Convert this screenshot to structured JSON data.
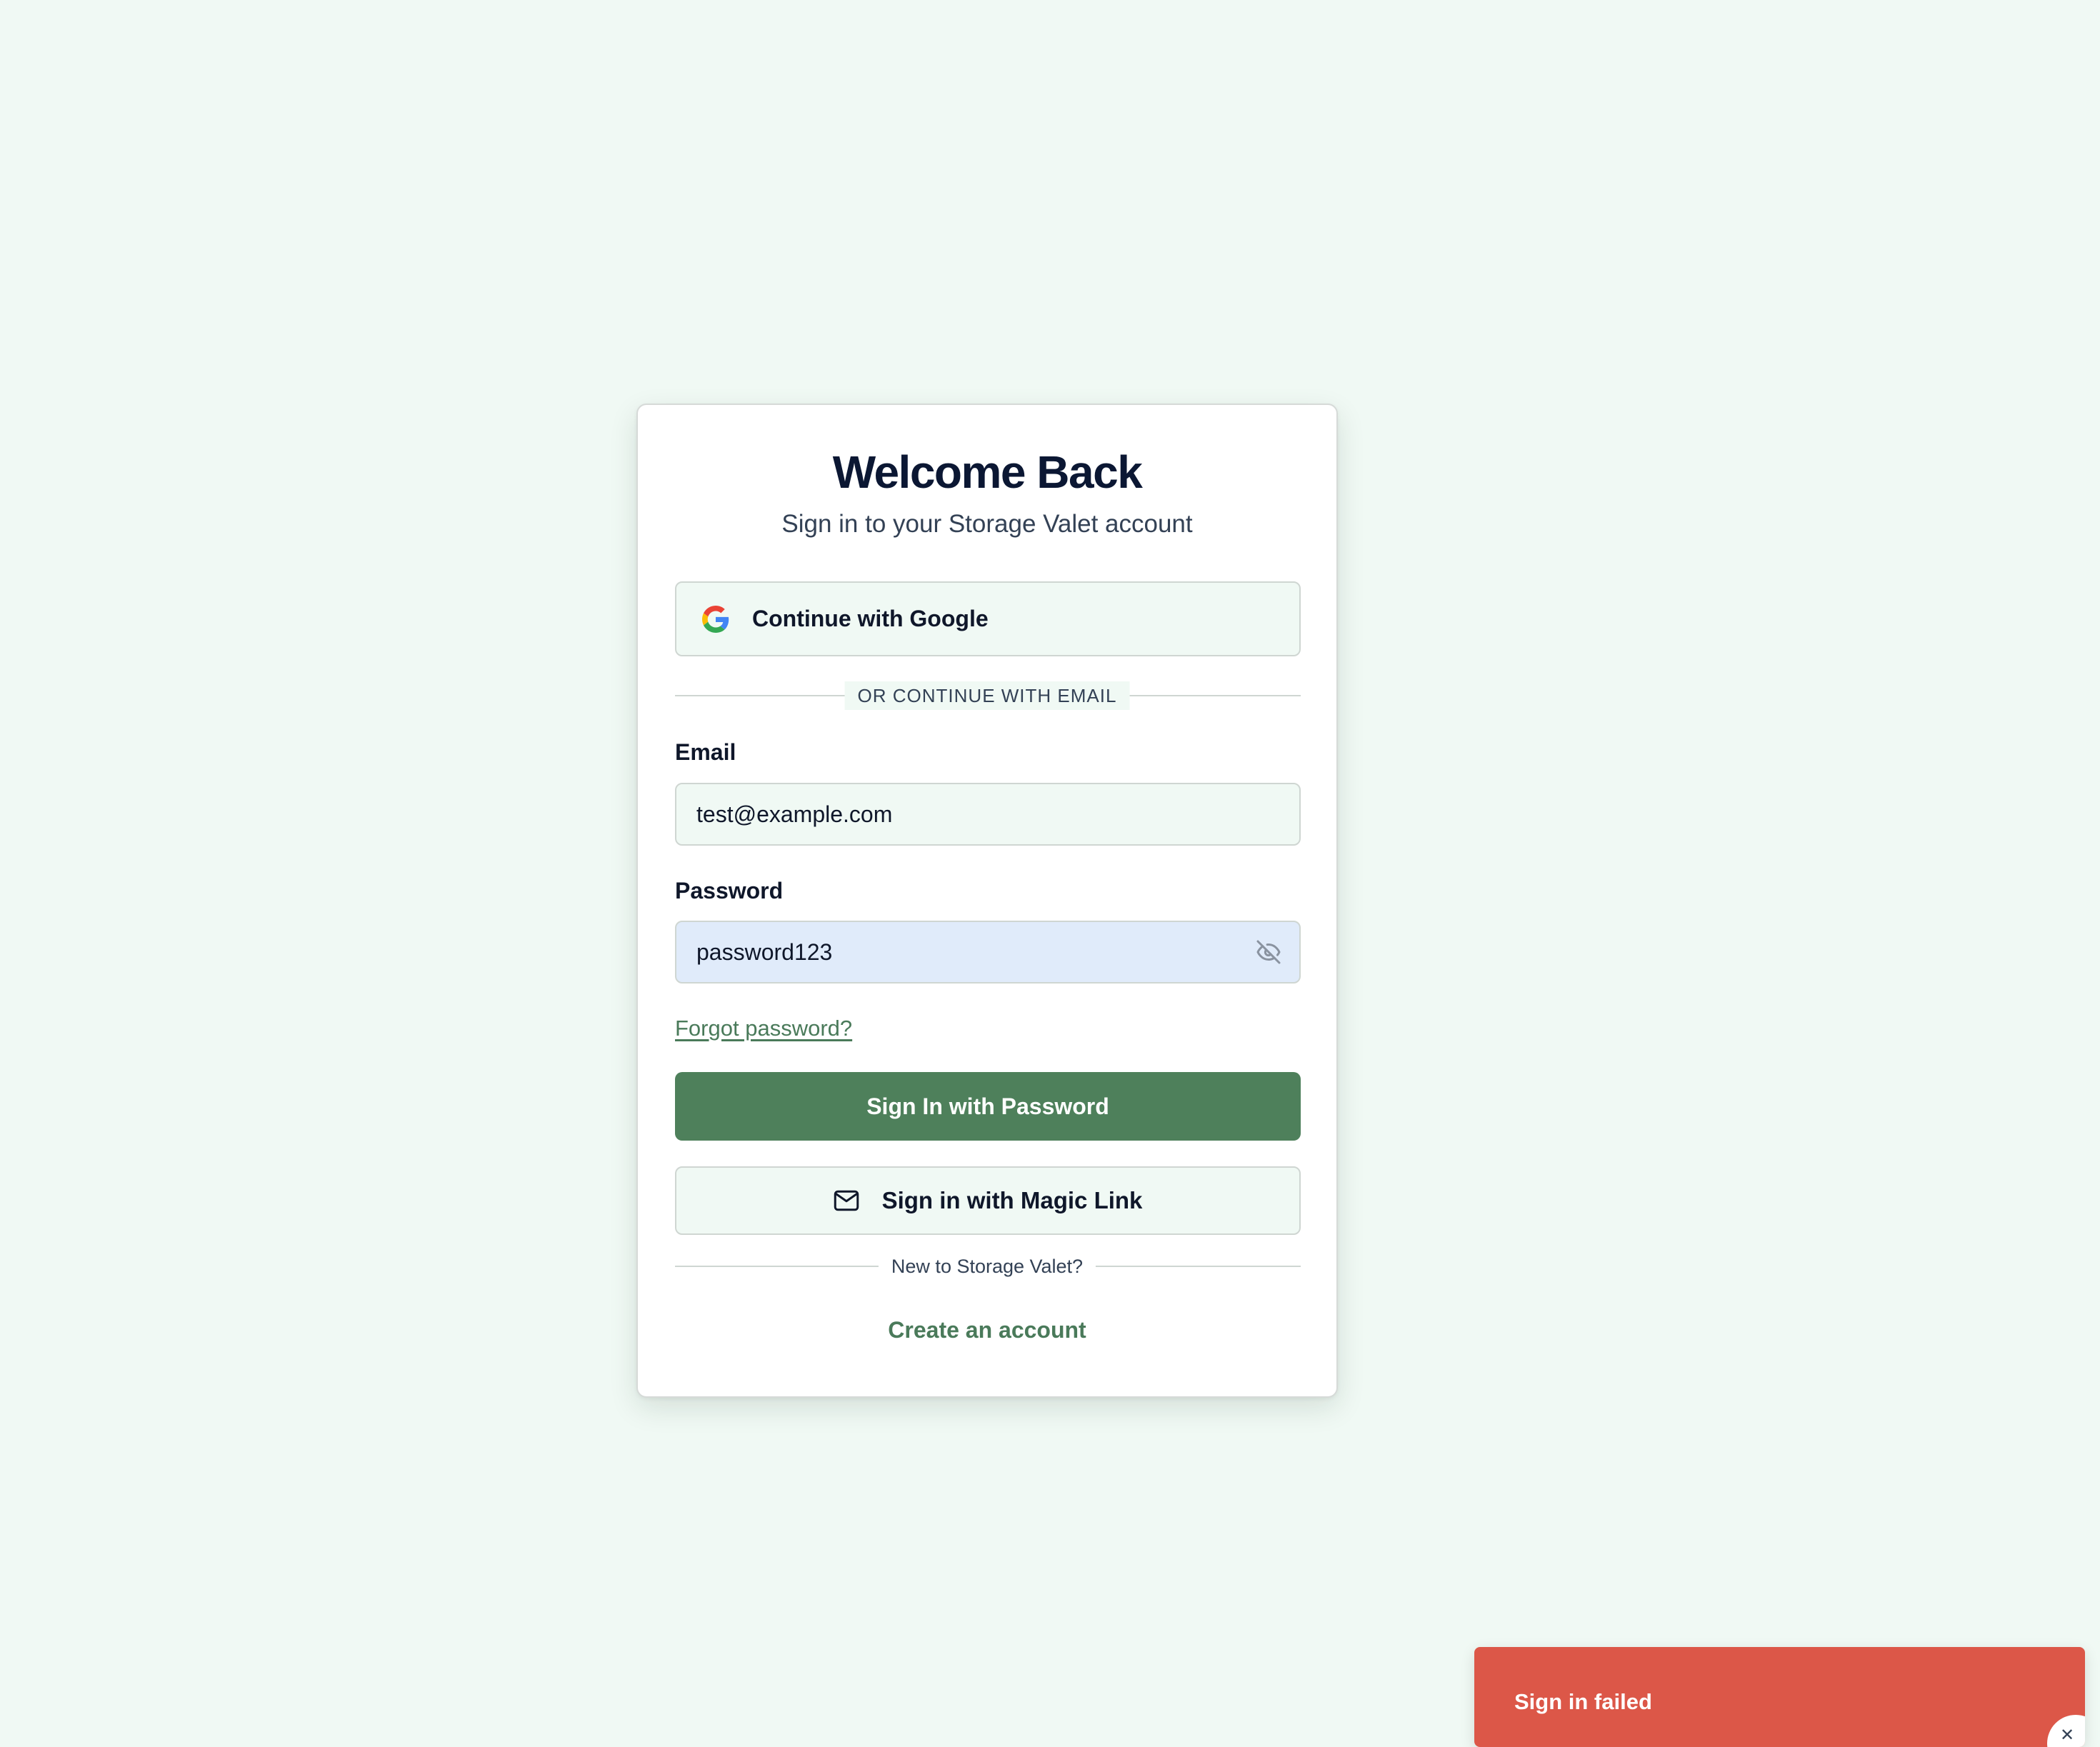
{
  "login": {
    "title": "Welcome Back",
    "subtitle": "Sign in to your Storage Valet account",
    "google_button": {
      "label": "Continue with Google",
      "icon": "google-icon"
    },
    "divider_label": "OR CONTINUE WITH EMAIL",
    "email": {
      "label": "Email",
      "value": "test@example.com"
    },
    "password": {
      "label": "Password",
      "value": "password123",
      "toggle_icon": "eye-off-icon"
    },
    "forgot_link": "Forgot password?",
    "primary_button": "Sign In with Password",
    "magic_button": {
      "label": "Sign in with Magic Link",
      "icon": "mail-icon"
    },
    "new_user_divider": "New to Storage Valet?",
    "create_account_link": "Create an account"
  },
  "toast": {
    "message": "Sign in failed",
    "close_icon": "close-icon"
  },
  "colors": {
    "background": "#f0f9f4",
    "card": "#ffffff",
    "primary": "#4e805b",
    "link": "#4a7a5a",
    "heading": "#0b1733",
    "error_toast": "#dc5748",
    "password_field": "#e0ebfa"
  }
}
